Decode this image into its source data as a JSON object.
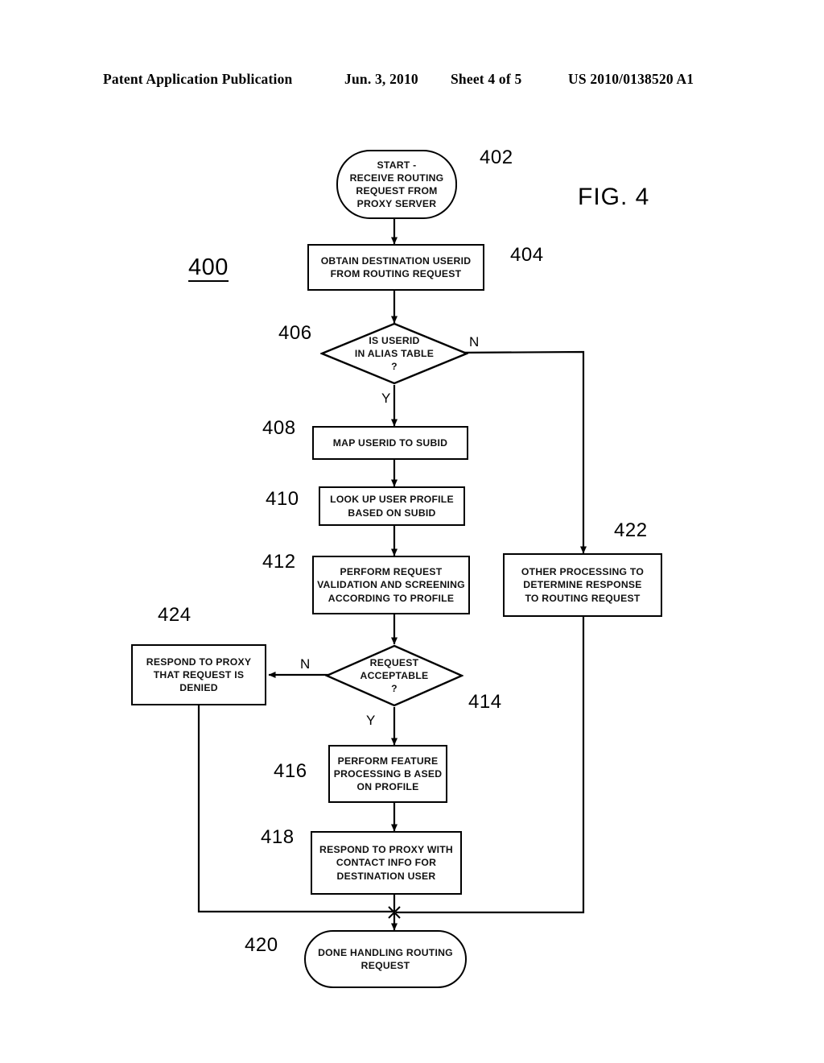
{
  "header": {
    "publication": "Patent Application Publication",
    "date": "Jun. 3, 2010",
    "sheet": "Sheet 4 of 5",
    "patent_number": "US 2010/0138520 A1"
  },
  "figure": {
    "caption": "FIG. 4",
    "figure_ref": "400"
  },
  "nodes": [
    {
      "ref": "402",
      "type": "terminal",
      "text": "START -\nRECEIVE ROUTING\nREQUEST FROM\nPROXY SERVER"
    },
    {
      "ref": "404",
      "type": "process",
      "text": "OBTAIN DESTINATION USERID\nFROM ROUTING REQUEST"
    },
    {
      "ref": "406",
      "type": "decision",
      "text": "IS USERID\nIN ALIAS TABLE\n?"
    },
    {
      "ref": "408",
      "type": "process",
      "text": "MAP USERID TO SUBID"
    },
    {
      "ref": "410",
      "type": "process",
      "text": "LOOK UP USER PROFILE\nBASED ON SUBID"
    },
    {
      "ref": "412",
      "type": "process",
      "text": "PERFORM REQUEST\nVALIDATION AND SCREENING\nACCORDING TO PROFILE"
    },
    {
      "ref": "414",
      "type": "decision",
      "text": "REQUEST\nACCEPTABLE\n?"
    },
    {
      "ref": "416",
      "type": "process",
      "text": "PERFORM FEATURE\nPROCESSING B ASED\nON PROFILE"
    },
    {
      "ref": "418",
      "type": "process",
      "text": "RESPOND TO PROXY WITH\nCONTACT INFO FOR\nDESTINATION USER"
    },
    {
      "ref": "420",
      "type": "terminal",
      "text": "DONE HANDLING ROUTING\nREQUEST"
    },
    {
      "ref": "422",
      "type": "process",
      "text": "OTHER PROCESSING TO\nDETERMINE RESPONSE\nTO ROUTING REQUEST"
    },
    {
      "ref": "424",
      "type": "process",
      "text": "RESPOND TO PROXY\nTHAT REQUEST IS\nDENIED"
    }
  ],
  "branch_labels": {
    "d406_no": "N",
    "d406_yes": "Y",
    "d414_no": "N",
    "d414_yes": "Y"
  },
  "colors": {
    "ink": "#000000",
    "paper": "#ffffff"
  }
}
